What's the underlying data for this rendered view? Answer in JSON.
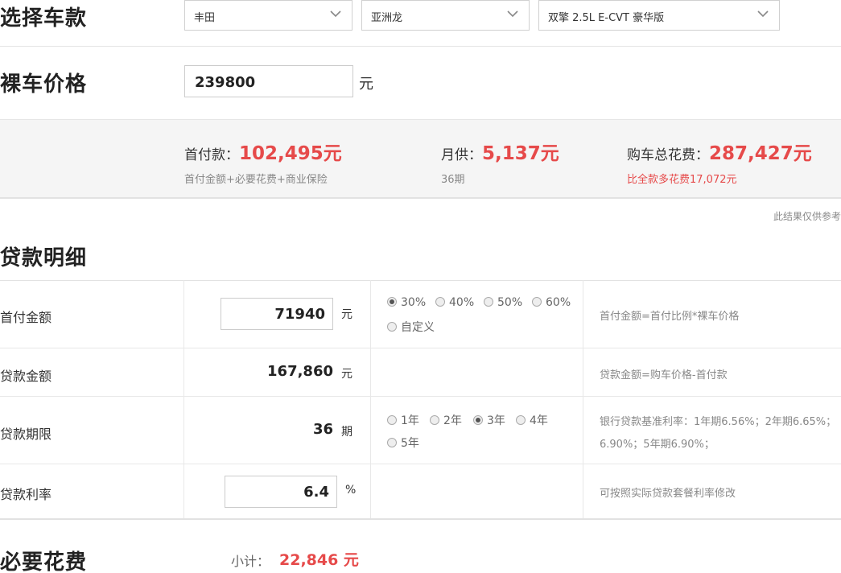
{
  "select_car": {
    "title": "选择车款",
    "brand": "丰田",
    "series": "亚洲龙",
    "model": "双擎 2.5L E-CVT 豪华版"
  },
  "bare_price": {
    "title": "裸车价格",
    "value": "239800",
    "unit": "元"
  },
  "summary": {
    "down_payment_label": "首付款：",
    "down_payment_value": "102,495元",
    "down_payment_sub": "首付金额+必要花费+商业保险",
    "monthly_label": "月供：",
    "monthly_value": "5,137元",
    "monthly_sub": "36期",
    "total_label": "购车总花费：",
    "total_value": "287,427元",
    "total_sub": "比全款多花费17,072元"
  },
  "ref_note": "此结果仅供参考",
  "loan_detail": {
    "title": "贷款明细",
    "rows": {
      "down": {
        "label": "首付金额",
        "value": "71940",
        "unit": "元",
        "options": [
          "30%",
          "40%",
          "50%",
          "60%",
          "自定义"
        ],
        "selected": "30%",
        "note": "首付金额=首付比例*裸车价格"
      },
      "loan": {
        "label": "贷款金额",
        "value": "167,860",
        "unit": "元",
        "note": "贷款金额=购车价格-首付款"
      },
      "term": {
        "label": "贷款期限",
        "value": "36",
        "unit": "期",
        "options": [
          "1年",
          "2年",
          "3年",
          "4年",
          "5年"
        ],
        "selected": "3年",
        "note_line1": "银行贷款基准利率：1年期6.56%；2年期6.65%；",
        "note_line2": "6.90%；5年期6.90%；"
      },
      "rate": {
        "label": "贷款利率",
        "value": "6.4",
        "unit": "%",
        "note": "可按照实际贷款套餐利率修改"
      }
    }
  },
  "necessary": {
    "title": "必要花费",
    "subtotal_label": "小计：",
    "subtotal_value": "22,846 元"
  }
}
